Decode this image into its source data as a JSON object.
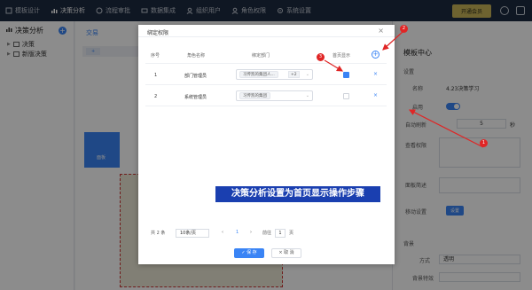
{
  "nav": {
    "items": [
      {
        "label": "模板设计",
        "icon": "template-icon"
      },
      {
        "label": "决策分析",
        "icon": "chart-icon",
        "active": true
      },
      {
        "label": "流程审批",
        "icon": "flow-icon"
      },
      {
        "label": "数据集成",
        "icon": "data-icon"
      },
      {
        "label": "组织用户",
        "icon": "users-icon"
      },
      {
        "label": "角色权限",
        "icon": "role-icon"
      },
      {
        "label": "系统设置",
        "icon": "settings-icon"
      }
    ],
    "open_member": "开通会员"
  },
  "sidebar": {
    "title": "决策分析",
    "items": [
      {
        "label": "决策"
      },
      {
        "label": "新版决策"
      }
    ]
  },
  "center": {
    "tab": "交易",
    "tile_label": "面板"
  },
  "right_panel": {
    "title": "模板中心",
    "section_setting": "设置",
    "name_label": "名称",
    "name_value": "4.23决策学习",
    "enable_label": "启用",
    "autorefresh_label": "自动刷新",
    "autorefresh_value": "5",
    "autorefresh_unit": "秒",
    "view_perm_label": "查看权限",
    "desc_label": "面板简述",
    "mobile_label": "移动设置",
    "mobile_btn": "设置",
    "section_bg": "背景",
    "mode_label": "方式",
    "mode_value": "透明",
    "bg_effect_label": "背景特效"
  },
  "modal": {
    "title": "绑定权限",
    "headers": {
      "index": "序号",
      "role": "角色名称",
      "dept": "绑定部门",
      "home": "首页显示"
    },
    "rows": [
      {
        "index": "1",
        "role": "部门管理员",
        "tags": [
          "习传凯的集团人...",
          "+2"
        ],
        "home": true
      },
      {
        "index": "2",
        "role": "系统管理员",
        "tags": [
          "习传凯的集团"
        ],
        "home": false
      }
    ],
    "pager": {
      "total": "共 2 条",
      "page_size": "10条/页",
      "current": "1",
      "goto_label": "前往",
      "goto_value": "1",
      "page_unit": "页"
    },
    "save_label": "保 存",
    "cancel_label": "取 消"
  },
  "annotation": {
    "banner": "决策分析设置为首页显示操作步骤",
    "badge1": "1",
    "badge2": "2",
    "badge3": "3"
  },
  "colors": {
    "accent": "#3a84f5",
    "nav_bg": "#1d2a40",
    "annotation_red": "#e02525",
    "banner_bg": "#1a3fb0"
  }
}
